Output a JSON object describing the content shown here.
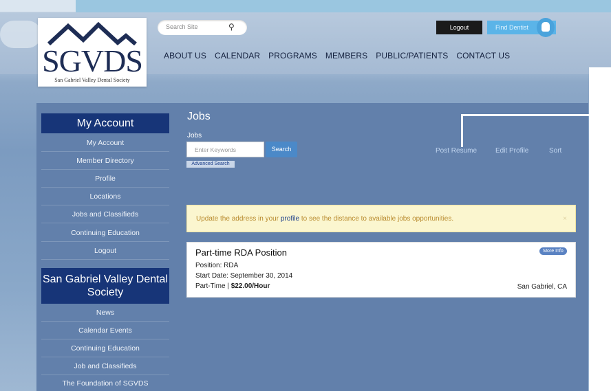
{
  "header": {
    "logo": {
      "abbr": "SGVDS",
      "full_name": "San Gabriel Valley Dental Society"
    },
    "search": {
      "placeholder": "Search Site"
    },
    "logout_label": "Logout",
    "find_dentist_label": "Find Dentist",
    "nav": [
      "ABOUT US",
      "CALENDAR",
      "PROGRAMS",
      "MEMBERS",
      "PUBLIC/PATIENTS",
      "CONTACT US"
    ]
  },
  "sidebar": {
    "account_heading": "My Account",
    "account_items": [
      "My Account",
      "Member Directory",
      "Profile",
      "Locations",
      "Jobs and Classifieds",
      "Continuing Education",
      "Logout"
    ],
    "society_heading": "San Gabriel Valley Dental Society",
    "society_items": [
      "News",
      "Calendar Events",
      "Continuing Education",
      "Job and Classifieds",
      "The Foundation of SGVDS"
    ]
  },
  "main": {
    "title": "Jobs",
    "jobs_label": "Jobs",
    "keywords_placeholder": "Enter Keywords",
    "search_label": "Search",
    "advanced_search_label": "Advanced Search",
    "links": [
      "Post Resume",
      "Edit Profile",
      "Sort"
    ],
    "alert": {
      "before": "Update the address in your",
      "link": "profile",
      "after": "to see the distance to available jobs opportunities.",
      "close": "×"
    },
    "job": {
      "title": "Part-time RDA Position",
      "more_info_label": "More Info",
      "position": "Position: RDA",
      "start_date": "Start Date: September 30, 2014",
      "type": "Part-Time",
      "rate": "$22.00/Hour",
      "location": "San Gabriel, CA"
    }
  },
  "colors": {
    "nav_dark": "#173578",
    "accent_blue": "#4b89c8",
    "alert_bg": "#fbf6cf"
  }
}
